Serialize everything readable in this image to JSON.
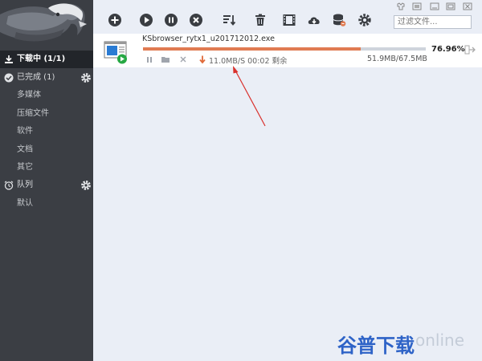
{
  "sidebar": {
    "items": [
      {
        "label": "下载中 (1/1)"
      },
      {
        "label": "已完成 (1)"
      },
      {
        "label": "多媒体"
      },
      {
        "label": "压缩文件"
      },
      {
        "label": "软件"
      },
      {
        "label": "文档"
      },
      {
        "label": "其它"
      },
      {
        "label": "队列"
      },
      {
        "label": "默认"
      }
    ]
  },
  "toolbar": {
    "icons": [
      "add-icon",
      "play-icon",
      "pause-icon",
      "stop-icon",
      "sort-icon",
      "trash-icon",
      "video-icon",
      "cloud-download-icon",
      "database-icon",
      "gear-icon"
    ],
    "search_placeholder": "过滤文件..."
  },
  "download": {
    "filename": "KSbrowser_rytx1_u201712012.exe",
    "progress": 0.7696,
    "percent": "76.96%",
    "speed": "11.0MB/S 00:02 剩余",
    "size": "51.9MB/67.5MB"
  },
  "watermark": {
    "brand": "谷普下载",
    "latin": "online"
  },
  "colors": {
    "sidebar": "#3b3e44",
    "active": "#22252a",
    "progress": "#e07b52",
    "main_bg": "#eaeef6",
    "annotation": "#d9302c"
  }
}
